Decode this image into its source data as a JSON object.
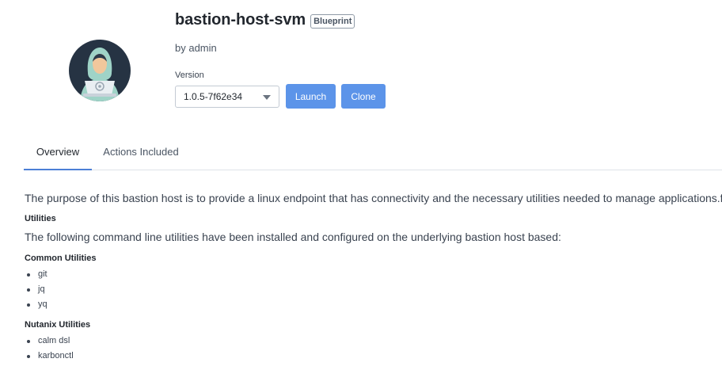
{
  "blueprint": {
    "name": "bastion-host-svm",
    "badge": "Blueprint",
    "author": "by admin",
    "avatar_icon": "hooded-hacker-avatar-icon"
  },
  "version": {
    "label": "Version",
    "selected": "1.0.5-7f62e34"
  },
  "actions": {
    "launch": "Launch",
    "clone": "Clone",
    "button_color": "#5c94e9"
  },
  "tabs": [
    {
      "label": "Overview",
      "active": true
    },
    {
      "label": "Actions Included",
      "active": false
    }
  ],
  "overview": {
    "intro": "The purpose of this bastion host is to provide a linux endpoint that has connectivity and the necessary utilities needed to manage applications.f",
    "utilities_heading": "Utilities",
    "utilities_text": "The following command line utilities have been installed and configured on the underlying bastion host based:",
    "common_heading": "Common Utilities",
    "common_items": [
      "git",
      "jq",
      "yq"
    ],
    "nutanix_heading": "Nutanix Utilities",
    "nutanix_items": [
      "calm dsl",
      "karbonctl"
    ]
  },
  "colors": {
    "accent": "#4c7fd6",
    "avatar_bg": "#263343"
  }
}
